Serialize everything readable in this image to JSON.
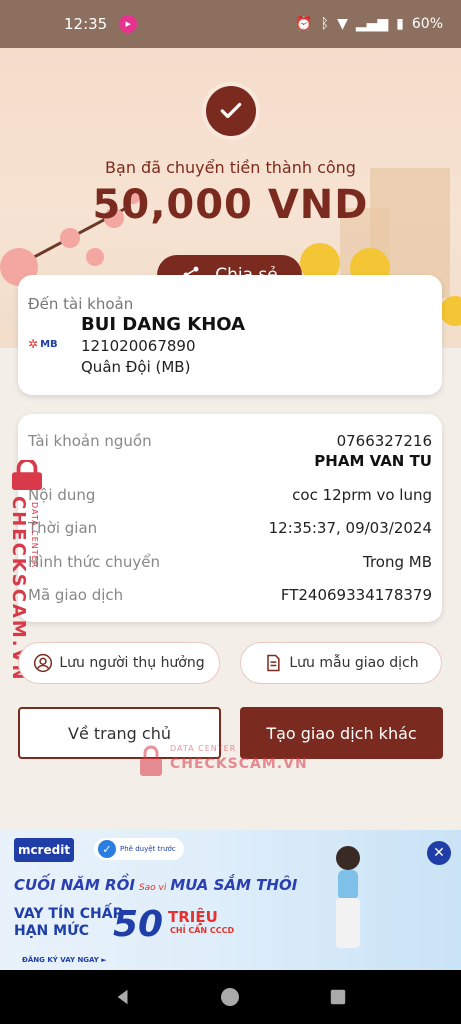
{
  "status_bar": {
    "time": "12:35",
    "battery": "60%"
  },
  "header": {
    "success_message": "Bạn đã chuyển tiền thành công",
    "amount": "50,000 VND",
    "share_label": "Chia sẻ"
  },
  "recipient": {
    "label": "Đến tài khoản",
    "bank_logo_text": "MB",
    "name": "BUI DANG KHOA",
    "account_number": "121020067890",
    "bank_name": "Quân Đội (MB)"
  },
  "details": {
    "source_label": "Tài khoản nguồn",
    "source_account": "0766327216",
    "source_name": "PHAM VAN TU",
    "content_label": "Nội dung",
    "content_value": "coc 12prm vo lung",
    "time_label": "Thời gian",
    "time_value": "12:35:37, 09/03/2024",
    "method_label": "Hình thức chuyển",
    "method_value": "Trong MB",
    "txn_label": "Mã giao dịch",
    "txn_value": "FT24069334178379"
  },
  "actions": {
    "save_recipient": "Lưu người thụ hưởng",
    "save_template": "Lưu mẫu giao dịch",
    "home": "Về trang chủ",
    "new_transaction": "Tạo giao dịch khác"
  },
  "watermark": {
    "vertical_big": "CHECKSCAM.VN",
    "vertical_small": "DATA CENTER",
    "center_small": "DATA CENTER",
    "center_big": "CHECKSCAM.VN"
  },
  "ad": {
    "brand": "mcredit",
    "approved": "Phê duyệt trước",
    "headline_a": "CUỐI NĂM RỒI",
    "headline_sub": "Sao vì",
    "headline_b": "MUA SẮM THÔI",
    "loan_line1": "VAY TÍN CHẤP",
    "loan_line2": "HẠN MỨC",
    "amount": "50",
    "unit": "TRIỆU",
    "cccd": "CHỈ CẦN CCCD",
    "cta": "ĐĂNG KÝ VAY NGAY ►"
  },
  "colors": {
    "brand": "#7a2a1f",
    "watermark": "#d93a4a",
    "ad_blue": "#1f3ea8"
  }
}
